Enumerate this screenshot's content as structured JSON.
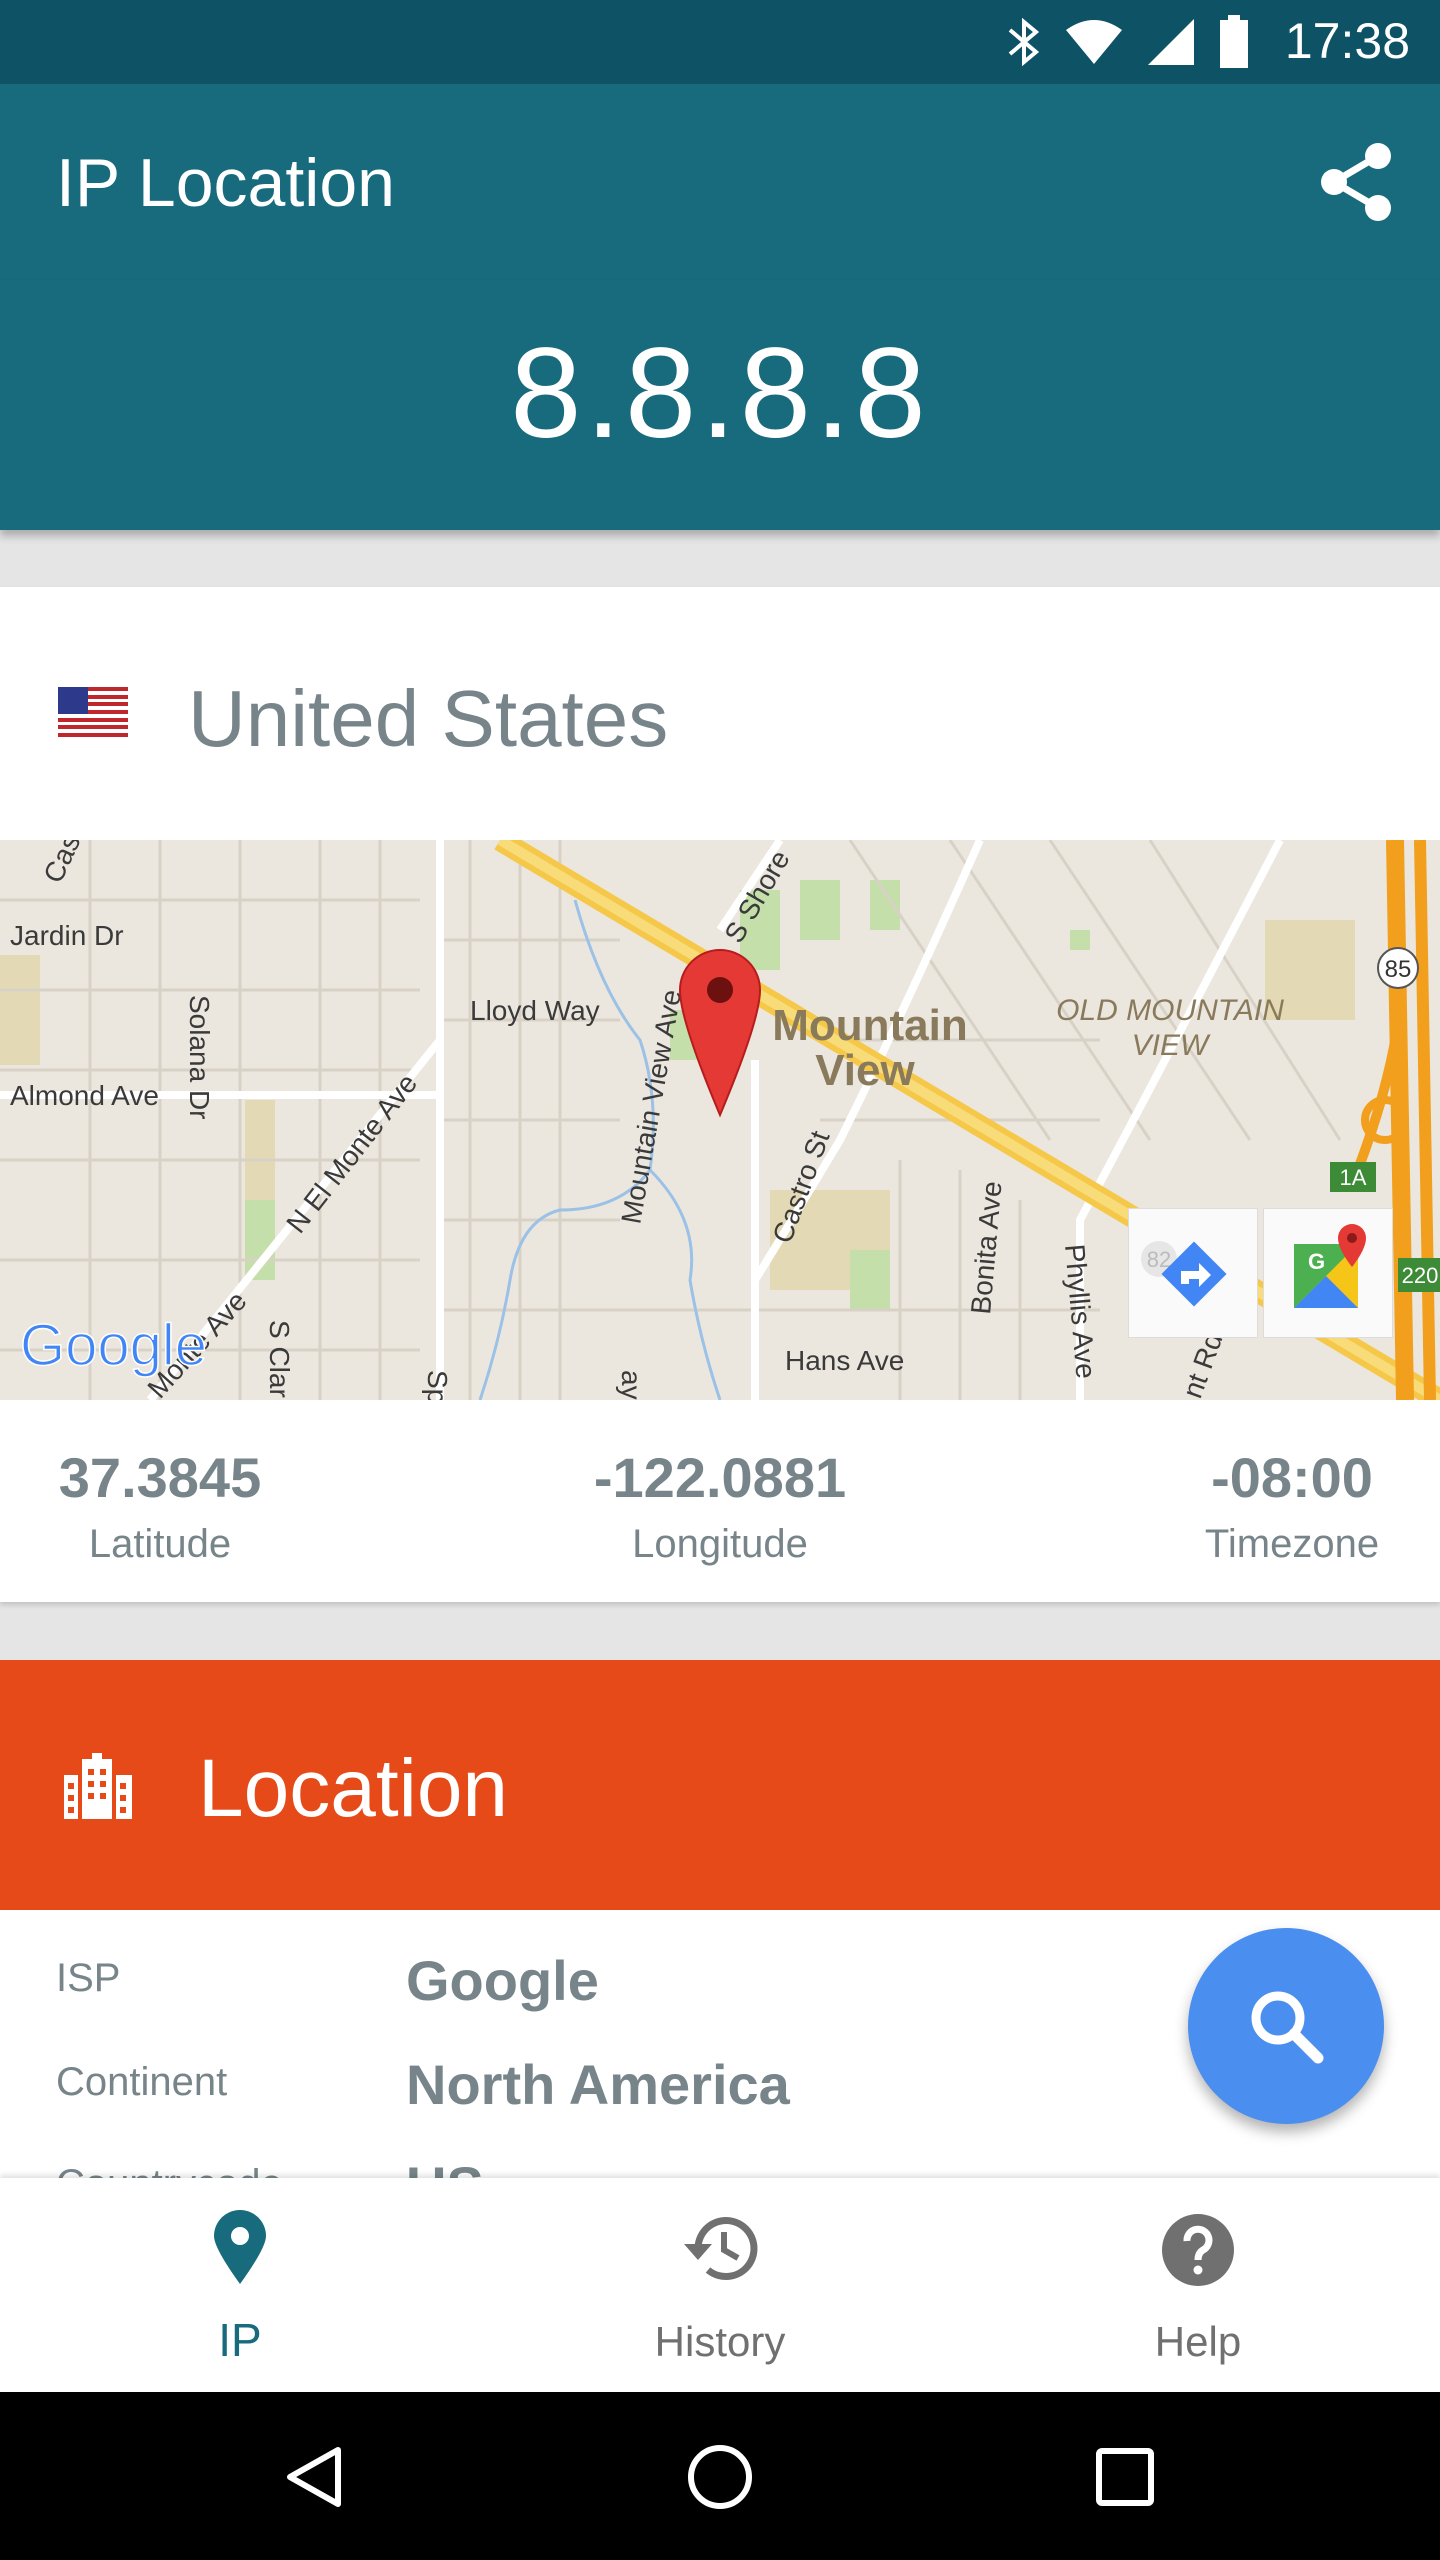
{
  "status_bar": {
    "time": "17:38"
  },
  "app_bar": {
    "title": "IP Location"
  },
  "ip_banner": {
    "ip": "8.8.8.8"
  },
  "country": {
    "name": "United States"
  },
  "map": {
    "labels": {
      "jardin": "Jardin Dr",
      "solana": "Solana Dr",
      "almond": "Almond Ave",
      "lloyd": "Lloyd Way",
      "mountain_view_ave": "Mountain View Ave",
      "elmonte": "N El Monte Ave",
      "mountain": "Mountain",
      "view": "View",
      "old_mv_1": "OLD MOUNTAIN",
      "old_mv_2": "VIEW",
      "castro": "Castro St",
      "bonita": "Bonita Ave",
      "phyllis": "Phyllis Ave",
      "hans": "Hans Ave",
      "shore": "S Shore",
      "monte": "Monte Ave",
      "sclar": "S Clar",
      "cas": "Cas",
      "ay": "ay",
      "sp": "Sp",
      "nt_rd": "nt Rd",
      "route_85": "85",
      "exit_1a": "1A",
      "route_220": "220",
      "route_82": "82",
      "google": "Google"
    }
  },
  "coords": {
    "latitude": {
      "value": "37.3845",
      "label": "Latitude"
    },
    "longitude": {
      "value": "-122.0881",
      "label": "Longitude"
    },
    "timezone": {
      "value": "-08:00",
      "label": "Timezone"
    }
  },
  "location_card": {
    "title": "Location",
    "rows": [
      {
        "key": "ISP",
        "value": "Google"
      },
      {
        "key": "Continent",
        "value": "North America"
      },
      {
        "key": "Countrycode",
        "value": "US"
      }
    ]
  },
  "bottom_nav": {
    "items": [
      {
        "label": "IP",
        "icon": "location-pin-icon",
        "active": true
      },
      {
        "label": "History",
        "icon": "history-icon",
        "active": false
      },
      {
        "label": "Help",
        "icon": "help-icon",
        "active": false
      }
    ]
  },
  "colors": {
    "status_bar": "#0d5265",
    "primary": "#176b7c",
    "accent_location": "#e64a19",
    "fab": "#4a8ef0",
    "text_secondary": "#77858a"
  }
}
